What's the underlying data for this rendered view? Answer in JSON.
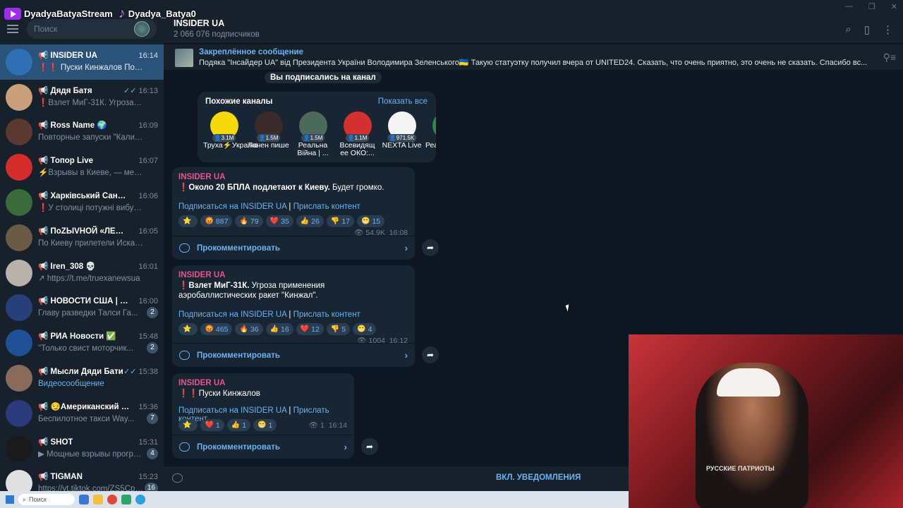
{
  "stream_banner": {
    "youtube": "DyadyaBatyaStream",
    "tiktok": "Dyadya_Batya0"
  },
  "sidebar": {
    "search_placeholder": "Поиск",
    "chats": [
      {
        "name": "INSIDER UA",
        "time": "16:14",
        "preview": "❗❗ Пуски Кинжалов  Подпис...",
        "active": true,
        "color": "#2f6fb4"
      },
      {
        "name": "Дядя Батя",
        "time": "16:13",
        "preview": "❗Взлет МиГ-31К. Угроза прим...",
        "checks": true,
        "color": "#c9a07c"
      },
      {
        "name": "Ross Name 🌍",
        "time": "16:09",
        "preview": "Повторные запуски \"Калибров\"...",
        "color": "#5a3a30"
      },
      {
        "name": "Топор Live",
        "time": "16:07",
        "preview": "⚡Взрывы в Киеве, — местные ...",
        "color": "#d42b2b"
      },
      {
        "name": "Харківський Санькоѕ",
        "time": "16:06",
        "preview": "❗У столиці потужні вибухи, по...",
        "color": "#3b6b3b"
      },
      {
        "name": "ПоZЫVНОЙ «ЛЕОН»",
        "time": "16:05",
        "preview": "По Киеву прилетели Искандер...",
        "color": "#6b5a45"
      },
      {
        "name": "Iren_308 💀",
        "time": "16:01",
        "preview": "↗ https://t.me/truexanewsua",
        "color": "#b9b2aa"
      },
      {
        "name": "НОВОСТИ США | АМЕ...",
        "time": "16:00",
        "preview": "Главу разведки Талси Га...",
        "badge": "2",
        "color": "#27407a"
      },
      {
        "name": "РИА Новости ✅",
        "time": "15:48",
        "preview": "\"Только свист моторчик...",
        "badge": "2",
        "color": "#1f4f95"
      },
      {
        "name": "Мысли Дяди Бати",
        "time": "15:38",
        "preview": "Видеосообщение",
        "checks": true,
        "blue": true,
        "color": "#8a6a5a"
      },
      {
        "name": "😏Американский тре...",
        "time": "15:36",
        "preview": "Беспилотное такси Way...",
        "badge": "7",
        "color": "#2a3a7a"
      },
      {
        "name": "SHOT",
        "time": "15:31",
        "preview": "▶ Мощные взрывы прогре...",
        "badge": "4",
        "color": "#1a1a1a"
      },
      {
        "name": "TIGMAN",
        "time": "15:23",
        "preview": "https://vt.tiktok.com/ZS5Cpe...",
        "badge": "16",
        "color": "#e0e0e0"
      }
    ]
  },
  "header": {
    "title": "INSIDER UA",
    "subscribers": "2 066 076 подписчиков"
  },
  "pinned": {
    "label": "Закреплённое сообщение",
    "text": "Подяка \"Інсайдер UA\" від Президента України Володимира Зеленського🇺🇦  Такую статуэтку получил вчера от UNITED24. Сказать, что очень приятно, это очень не сказать.   Спасибо вс..."
  },
  "service_message": "Вы подписались на канал",
  "similar": {
    "title": "Похожие каналы",
    "show_all": "Показать все",
    "channels": [
      {
        "name": "Труха⚡Україна",
        "count": "3.1M",
        "color": "#f5d90a"
      },
      {
        "name": "Лачен пише",
        "count": "1.5M",
        "color": "#3a2a2a"
      },
      {
        "name": "Реальна Війна | ...",
        "count": "1.5M",
        "color": "#4a6a5a"
      },
      {
        "name": "Всевидящ ее ОКО:...",
        "count": "1.1M",
        "color": "#d43030"
      },
      {
        "name": "NEXTA Live",
        "count": "971.5K",
        "color": "#f4f4f4"
      },
      {
        "name": "Реальн Київ",
        "count": "",
        "color": "#2a8a4a"
      }
    ]
  },
  "messages": [
    {
      "author": "INSIDER UA",
      "text_bold": "Около 20 БПЛА подлетают к Киеву.",
      "text": " Будет громко.",
      "link1": "Подписаться на INSIDER UA",
      "sep": "|",
      "link2": "Прислать контент",
      "reactions": [
        [
          "⭐",
          ""
        ],
        [
          "😡",
          "887"
        ],
        [
          "🔥",
          "79"
        ],
        [
          "❤️",
          "35"
        ],
        [
          "👍",
          "26"
        ],
        [
          "👎",
          "17"
        ],
        [
          "😁",
          "15"
        ]
      ],
      "views": "54.9K",
      "time": "16:08",
      "comment": "Прокомментировать"
    },
    {
      "author": "INSIDER UA",
      "text_bold": "Взлет МиГ-31К.",
      "text": " Угроза применения аэробаллистических ракет \"Кинжал\".",
      "link1": "Подписаться на INSIDER UA",
      "sep": "|",
      "link2": "Прислать контент",
      "reactions": [
        [
          "⭐",
          ""
        ],
        [
          "😡",
          "465"
        ],
        [
          "🔥",
          "36"
        ],
        [
          "👍",
          "16"
        ],
        [
          "❤️",
          "12"
        ],
        [
          "👎",
          "5"
        ],
        [
          "😁",
          "4"
        ]
      ],
      "views": "1004",
      "time": "16:12",
      "comment": "Прокомментировать"
    },
    {
      "author": "INSIDER UA",
      "text_bold": "",
      "text": "Пуски Кинжалов",
      "link1": "Подписаться на INSIDER UA",
      "sep": "|",
      "link2": "Прислать контент",
      "reactions": [
        [
          "⭐",
          ""
        ],
        [
          "❤️",
          "1"
        ],
        [
          "👍",
          "1"
        ],
        [
          "😁",
          "1"
        ]
      ],
      "views": "1",
      "time": "16:14",
      "comment": "Прокомментировать"
    }
  ],
  "bottom": {
    "notify": "ВКЛ. УВЕДОМЛЕНИЯ"
  },
  "webcam": {
    "shirt_text": "РУССКИЕ ПАТРИОТЫ"
  },
  "taskbar": {
    "search": "Поиск"
  }
}
